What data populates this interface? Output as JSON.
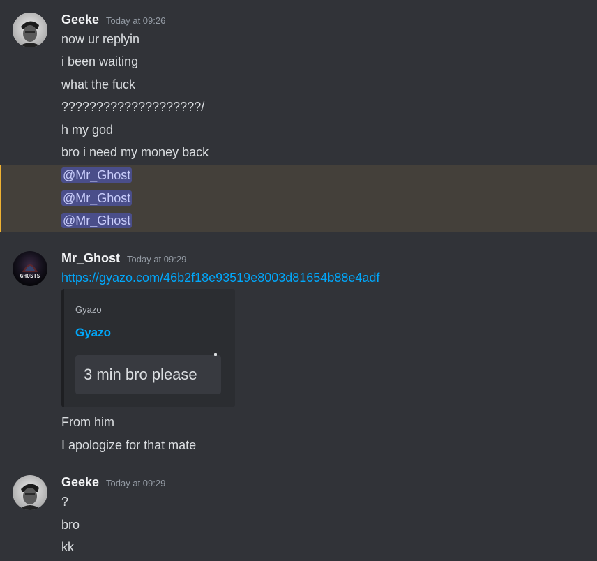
{
  "messages": [
    {
      "author": "Geeke",
      "timestamp": "Today at 09:26",
      "avatar": "geeke-avatar",
      "lines": [
        "now ur replyin",
        "i been waiting",
        "what the fuck",
        "????????????????????/",
        "h my god",
        "bro i need my money back"
      ],
      "mentions": [
        "@Mr_Ghost",
        "@Mr_Ghost",
        "@Mr_Ghost"
      ]
    },
    {
      "author": "Mr_Ghost",
      "timestamp": "Today at 09:29",
      "avatar": "ghosts-avatar",
      "avatar_text": "GHOSTS",
      "link": "https://gyazo.com/46b2f18e93519e8003d81654b88e4adf",
      "embed": {
        "provider": "Gyazo",
        "title": "Gyazo",
        "image_text": "3 min bro please"
      },
      "lines": [
        "From him",
        "I apologize for that mate"
      ]
    },
    {
      "author": "Geeke",
      "timestamp": "Today at 09:29",
      "avatar": "geeke-avatar",
      "lines": [
        "?",
        "bro",
        "kk"
      ]
    }
  ],
  "colors": {
    "background": "#313338",
    "mention_highlight": "#44403a",
    "mention_bar": "#f0b232",
    "mention_pill": "#4a4e8a",
    "link": "#00a8fc"
  }
}
